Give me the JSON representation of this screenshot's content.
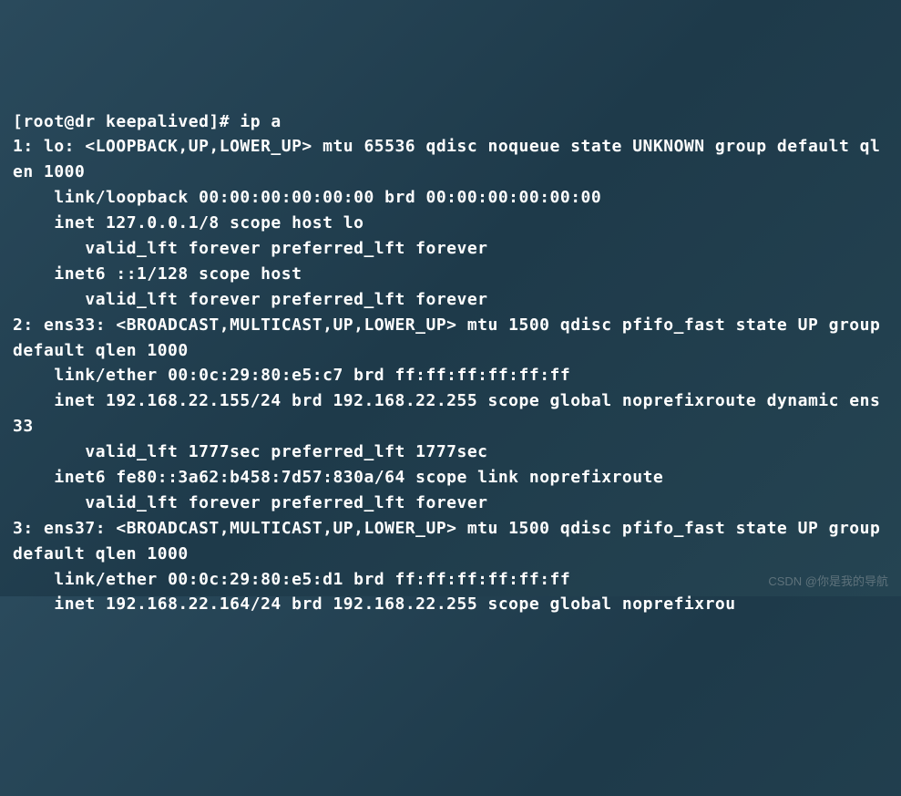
{
  "terminal": {
    "prompt": "[root@dr keepalived]# ",
    "command": "ip a",
    "lines": [
      "1: lo: <LOOPBACK,UP,LOWER_UP> mtu 65536 qdisc noqueue state UNKNOWN group default qlen 1000",
      "    link/loopback 00:00:00:00:00:00 brd 00:00:00:00:00:00",
      "    inet 127.0.0.1/8 scope host lo",
      "       valid_lft forever preferred_lft forever",
      "    inet6 ::1/128 scope host ",
      "       valid_lft forever preferred_lft forever",
      "2: ens33: <BROADCAST,MULTICAST,UP,LOWER_UP> mtu 1500 qdisc pfifo_fast state UP group default qlen 1000",
      "    link/ether 00:0c:29:80:e5:c7 brd ff:ff:ff:ff:ff:ff",
      "    inet 192.168.22.155/24 brd 192.168.22.255 scope global noprefixroute dynamic ens33",
      "       valid_lft 1777sec preferred_lft 1777sec",
      "    inet6 fe80::3a62:b458:7d57:830a/64 scope link noprefixroute ",
      "       valid_lft forever preferred_lft forever",
      "3: ens37: <BROADCAST,MULTICAST,UP,LOWER_UP> mtu 1500 qdisc pfifo_fast state UP group default qlen 1000",
      "    link/ether 00:0c:29:80:e5:d1 brd ff:ff:ff:ff:ff:ff",
      "    inet 192.168.22.164/24 brd 192.168.22.255 scope global noprefixrou"
    ]
  },
  "watermark": "CSDN @你是我的导航"
}
